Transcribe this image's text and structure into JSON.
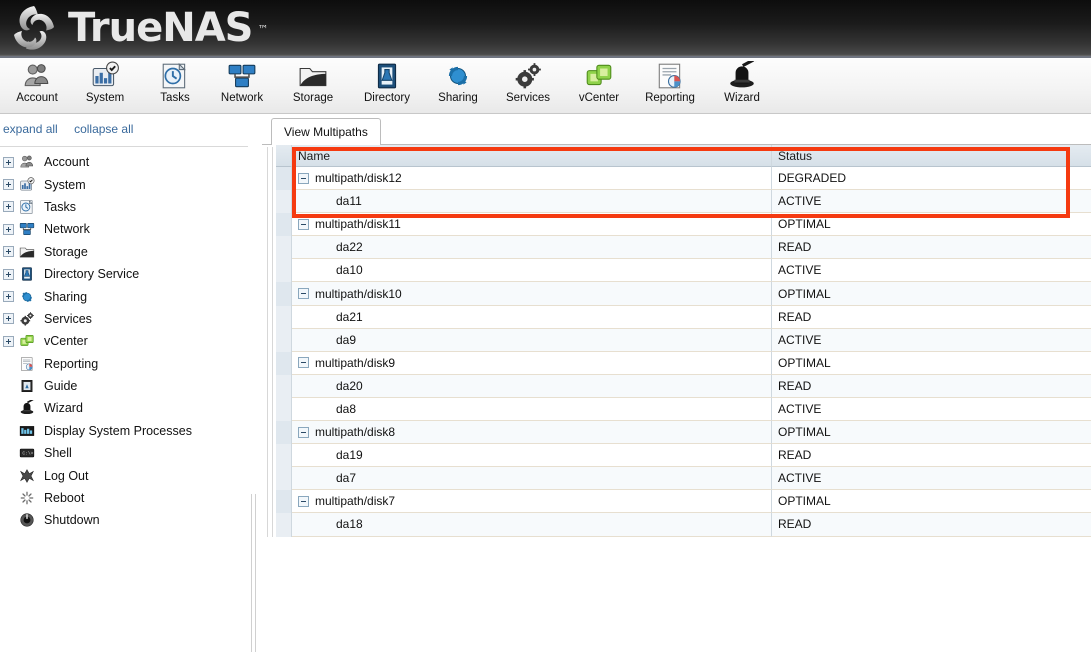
{
  "app": {
    "brand": "TrueNAS",
    "brand_tm": "™",
    "logo_icon": "truenas-swirl-logo"
  },
  "toolbar": {
    "items": [
      {
        "label": "Account",
        "icon": "account-icon"
      },
      {
        "label": "System",
        "icon": "system-icon"
      },
      {
        "label": "Tasks",
        "icon": "tasks-icon"
      },
      {
        "label": "Network",
        "icon": "network-icon"
      },
      {
        "label": "Storage",
        "icon": "storage-icon"
      },
      {
        "label": "Directory",
        "icon": "directory-icon"
      },
      {
        "label": "Sharing",
        "icon": "sharing-icon"
      },
      {
        "label": "Services",
        "icon": "services-icon"
      },
      {
        "label": "vCenter",
        "icon": "vcenter-icon"
      },
      {
        "label": "Reporting",
        "icon": "reporting-icon"
      },
      {
        "label": "Wizard",
        "icon": "wizard-icon"
      }
    ]
  },
  "sidebar": {
    "expand_all": "expand all",
    "collapse_all": "collapse all",
    "tree": [
      {
        "label": "Account",
        "icon": "account-icon",
        "expandable": true
      },
      {
        "label": "System",
        "icon": "system-icon",
        "expandable": true
      },
      {
        "label": "Tasks",
        "icon": "tasks-icon",
        "expandable": true
      },
      {
        "label": "Network",
        "icon": "network-icon",
        "expandable": true
      },
      {
        "label": "Storage",
        "icon": "storage-icon",
        "expandable": true
      },
      {
        "label": "Directory Service",
        "icon": "directory-icon",
        "expandable": true
      },
      {
        "label": "Sharing",
        "icon": "sharing-icon",
        "expandable": true
      },
      {
        "label": "Services",
        "icon": "services-icon",
        "expandable": true
      },
      {
        "label": "vCenter",
        "icon": "vcenter-icon",
        "expandable": true
      },
      {
        "label": "Reporting",
        "icon": "reporting-icon",
        "expandable": false
      },
      {
        "label": "Guide",
        "icon": "guide-icon",
        "expandable": false
      },
      {
        "label": "Wizard",
        "icon": "wizard-icon",
        "expandable": false
      },
      {
        "label": "Display System Processes",
        "icon": "processes-icon",
        "expandable": false
      },
      {
        "label": "Shell",
        "icon": "shell-icon",
        "expandable": false
      },
      {
        "label": "Log Out",
        "icon": "logout-icon",
        "expandable": false
      },
      {
        "label": "Reboot",
        "icon": "reboot-icon",
        "expandable": false
      },
      {
        "label": "Shutdown",
        "icon": "shutdown-icon",
        "expandable": false
      }
    ]
  },
  "content": {
    "tabs": [
      {
        "label": "View Multipaths",
        "active": true
      }
    ],
    "grid": {
      "columns": [
        "Name",
        "Status"
      ],
      "rows": [
        {
          "name": "multipath/disk12",
          "status": "DEGRADED",
          "level": "parent",
          "highlighted": true
        },
        {
          "name": "da11",
          "status": "ACTIVE",
          "level": "child",
          "highlighted": true
        },
        {
          "name": "multipath/disk11",
          "status": "OPTIMAL",
          "level": "parent",
          "highlighted": false
        },
        {
          "name": "da22",
          "status": "READ",
          "level": "child",
          "highlighted": false
        },
        {
          "name": "da10",
          "status": "ACTIVE",
          "level": "child",
          "highlighted": false
        },
        {
          "name": "multipath/disk10",
          "status": "OPTIMAL",
          "level": "parent",
          "highlighted": false
        },
        {
          "name": "da21",
          "status": "READ",
          "level": "child",
          "highlighted": false
        },
        {
          "name": "da9",
          "status": "ACTIVE",
          "level": "child",
          "highlighted": false
        },
        {
          "name": "multipath/disk9",
          "status": "OPTIMAL",
          "level": "parent",
          "highlighted": false
        },
        {
          "name": "da20",
          "status": "READ",
          "level": "child",
          "highlighted": false
        },
        {
          "name": "da8",
          "status": "ACTIVE",
          "level": "child",
          "highlighted": false
        },
        {
          "name": "multipath/disk8",
          "status": "OPTIMAL",
          "level": "parent",
          "highlighted": false
        },
        {
          "name": "da19",
          "status": "READ",
          "level": "child",
          "highlighted": false
        },
        {
          "name": "da7",
          "status": "ACTIVE",
          "level": "child",
          "highlighted": false
        },
        {
          "name": "multipath/disk7",
          "status": "OPTIMAL",
          "level": "parent",
          "highlighted": false
        },
        {
          "name": "da18",
          "status": "READ",
          "level": "child",
          "highlighted": false
        }
      ]
    }
  },
  "colors": {
    "highlight_box": "#f53a10",
    "header_dark": "#141414",
    "link_blue": "#3a6a9c",
    "grid_header": "#d6e0e8"
  }
}
